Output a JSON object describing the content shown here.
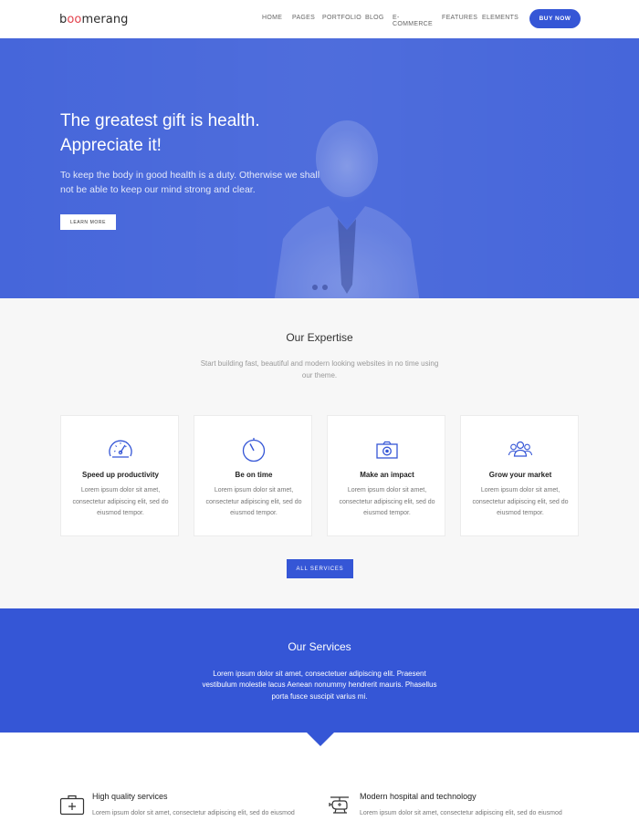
{
  "header": {
    "logo_start": "b",
    "logo_oo": "oo",
    "logo_end": "merang",
    "nav": [
      "HOME",
      "PAGES",
      "PORTFOLIO",
      "BLOG",
      "E-COMMERCE",
      "FEATURES",
      "ELEMENTS"
    ],
    "cta": "BUY NOW"
  },
  "hero": {
    "title_line1": "The greatest gift is health.",
    "title_line2": "Appreciate it!",
    "text": "To keep the body in good health is a duty. Otherwise we shall not be able to keep our mind strong and clear.",
    "button": "LEARN MORE",
    "slides": 2
  },
  "expertise": {
    "title": "Our Expertise",
    "subtitle": "Start building fast, beautiful and modern looking websites in no time using our theme.",
    "cards": [
      {
        "icon": "speedometer-icon",
        "title": "Speed up productivity",
        "text": "Lorem ipsum dolor sit amet, consectetur adipiscing elit, sed do eiusmod tempor."
      },
      {
        "icon": "stopwatch-icon",
        "title": "Be on time",
        "text": "Lorem ipsum dolor sit amet, consectetur adipiscing elit, sed do eiusmod tempor."
      },
      {
        "icon": "camera-icon",
        "title": "Make an impact",
        "text": "Lorem ipsum dolor sit amet, consectetur adipiscing elit, sed do eiusmod tempor."
      },
      {
        "icon": "people-icon",
        "title": "Grow your market",
        "text": "Lorem ipsum dolor sit amet, consectetur adipiscing elit, sed do eiusmod tempor."
      }
    ],
    "button": "ALL SERVICES"
  },
  "services": {
    "title": "Our Services",
    "text": "Lorem ipsum dolor sit amet, consectetuer adipiscing elit. Praesent vestibulum molestie lacus Aenean nonummy hendrerit mauris. Phasellus porta fusce suscipit varius mi."
  },
  "features": [
    {
      "icon": "first-aid-kit-icon",
      "title": "High quality services",
      "text": "Lorem ipsum dolor sit amet, consectetur adipiscing elit, sed do eiusmod"
    },
    {
      "icon": "helicopter-icon",
      "title": "Modern hospital and technology",
      "text": "Lorem ipsum dolor sit amet, consectetur adipiscing elit, sed do eiusmod"
    }
  ],
  "colors": {
    "accent": "#3556d6",
    "hero": "#4061d9",
    "logo_oo": "#e3424d"
  }
}
